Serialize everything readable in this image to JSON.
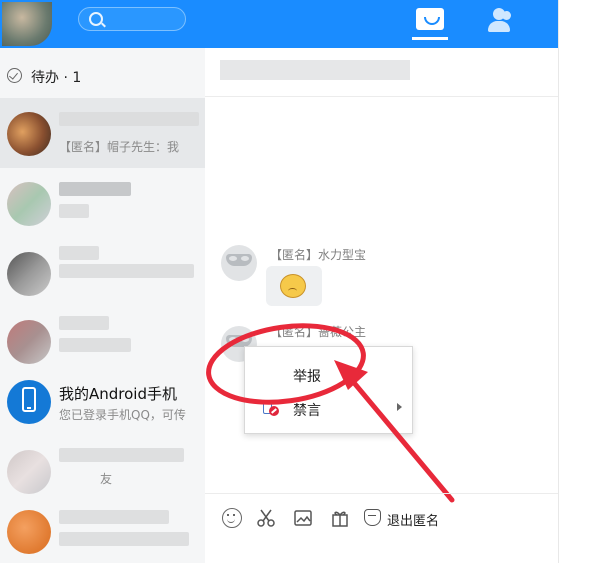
{
  "topbar": {
    "search_placeholder": "",
    "accent": "#1a8cff",
    "icons": [
      "search-icon",
      "message-icon",
      "contacts-icon"
    ]
  },
  "sidebar": {
    "todo_label": "待办 · 1",
    "conversations": [
      {
        "title": "",
        "preview": "【匿名】帽子先生：我",
        "active": true
      },
      {
        "title": "",
        "preview": "",
        "active": false
      },
      {
        "title": "",
        "preview": "",
        "active": false
      },
      {
        "title": "",
        "preview": "",
        "active": false
      },
      {
        "title": "我的Android手机",
        "preview": "您已登录手机QQ，可传",
        "active": false
      },
      {
        "title": "",
        "preview": "友",
        "active": false
      },
      {
        "title": "",
        "preview": "",
        "active": false
      }
    ]
  },
  "chat": {
    "title": "",
    "messages": [
      {
        "sender": "【匿名】水力型宝",
        "content_type": "sticker",
        "sticker_icon": "emoji-sticker-icon"
      },
      {
        "sender": "【匿名】蔷薇公主",
        "content_type": "text",
        "text": ""
      }
    ]
  },
  "context_menu": {
    "items": [
      {
        "label": "举报",
        "icon": ""
      },
      {
        "label": "禁言",
        "icon": "mute-icon",
        "has_submenu": true
      }
    ]
  },
  "annotation": {
    "color": "#e8293a"
  },
  "toolbar": {
    "icons": [
      "emoji-icon",
      "scissors-icon",
      "image-icon",
      "gift-icon",
      "anonymous-mask-icon"
    ],
    "exit_anonymous_label": "退出匿名"
  }
}
